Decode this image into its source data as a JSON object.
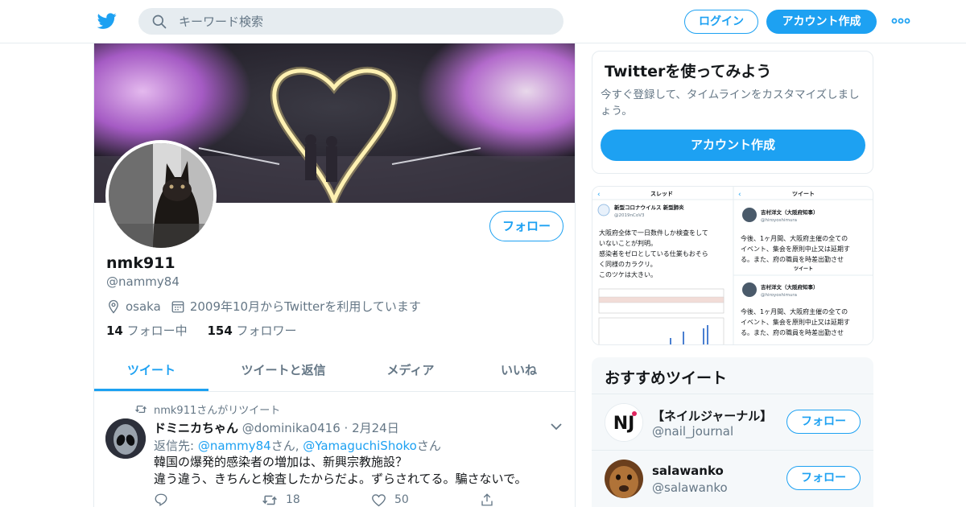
{
  "header": {
    "search_placeholder": "キーワード検索",
    "login_label": "ログイン",
    "signup_label": "アカウント作成",
    "accent": "#1da1f2"
  },
  "profile": {
    "follow_label": "フォロー",
    "name": "nmk911",
    "handle": "@nammy84",
    "location": "osaka",
    "joined": "2009年10月からTwitterを利用しています",
    "following_count": "14",
    "following_label": "フォロー中",
    "followers_count": "154",
    "followers_label": "フォロワー"
  },
  "tabs": [
    {
      "label": "ツイート",
      "active": true
    },
    {
      "label": "ツイートと返信",
      "active": false
    },
    {
      "label": "メディア",
      "active": false
    },
    {
      "label": "いいね",
      "active": false
    }
  ],
  "tweet": {
    "retweeted_by": "nmk911さんがリツイート",
    "author_name": "ドミニカちゃん",
    "author_handle": "@dominika0416",
    "separator": "·",
    "date": "2月24日",
    "reply_prefix": "返信先: ",
    "reply_user1": "@nammy84",
    "reply_san1": "さん, ",
    "reply_user2": "@YamaguchiShoko",
    "reply_san2": "さん",
    "text_line1": "韓国の爆発的感染者の増加は、新興宗教施設？",
    "text_line2": "違う違う、きちんと検査したからだよ。ずらされてる。騙さないで。",
    "retweet_count": "18",
    "like_count": "50"
  },
  "sidebar": {
    "try_title": "Twitterを使ってみよう",
    "try_text": "今すぐ登録して、タイムラインをカスタマイズしましょう。",
    "try_cta": "アカウント作成",
    "promo": {
      "left_header": "スレッド",
      "left_title": "新型コロナウイルス 新型肺炎",
      "left_handle": "@2019nCoV3",
      "left_body": [
        "大阪府全体で一日数件しか検査をして",
        "いないことが判明。",
        "感染者をゼロとしている仕業もおそら",
        "く同様のカラクリ。",
        "このツケは大きい。"
      ],
      "right_header": "ツイート",
      "right_name": "吉村洋文（大阪府知事）",
      "right_handle": "@hiroyoshimura",
      "right_body": [
        "今後、1ヶ月間、大阪府主催の全ての",
        "イベント、集会を原則中止又は延期す",
        "る。また、府の職員を時差出勤させ"
      ],
      "right_header2": "ツイート",
      "right_body2": [
        "今後、1ヶ月間、大阪府主催の全ての",
        "イベント、集会を原則中止又は延期す",
        "る。また、府の職員を時差出勤させ"
      ]
    },
    "reco_title": "おすすめツイート",
    "reco": [
      {
        "name": "【ネイルジャーナル】",
        "handle": "@nail_journal",
        "follow": "フォロー",
        "logo_text": "NJ"
      },
      {
        "name": "salawanko",
        "handle": "@salawanko",
        "follow": "フォロー"
      }
    ]
  },
  "icons": [
    "twitter-bird-icon",
    "search-icon",
    "more-icon",
    "location-icon",
    "calendar-icon",
    "retweet-icon",
    "chevron-down-icon",
    "reply-icon",
    "like-icon",
    "share-icon"
  ]
}
